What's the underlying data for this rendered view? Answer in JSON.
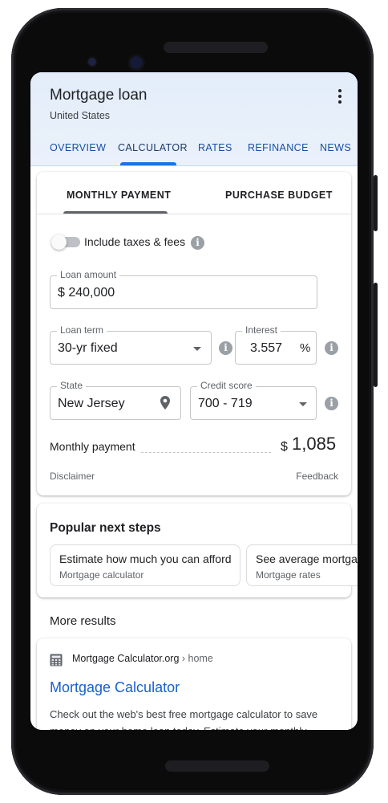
{
  "header": {
    "title": "Mortgage loan",
    "subtitle": "United States",
    "tabs": [
      {
        "label": "OVERVIEW"
      },
      {
        "label": "CALCULATOR",
        "active": true
      },
      {
        "label": "RATES"
      },
      {
        "label": "REFINANCE"
      },
      {
        "label": "NEWS"
      }
    ]
  },
  "calculator": {
    "tabs": [
      {
        "label": "MONTHLY PAYMENT",
        "active": true
      },
      {
        "label": "PURCHASE BUDGET"
      }
    ],
    "toggle": {
      "label": "Include taxes & fees",
      "on": false
    },
    "loan_amount": {
      "label": "Loan amount",
      "value": "$ 240,000"
    },
    "loan_term": {
      "label": "Loan term",
      "value": "30-yr fixed"
    },
    "interest": {
      "label": "Interest",
      "value": "3.557",
      "unit": "%"
    },
    "state": {
      "label": "State",
      "value": "New Jersey"
    },
    "credit_score": {
      "label": "Credit score",
      "value": "700 - 719"
    },
    "monthly_payment": {
      "label": "Monthly payment",
      "currency": "$",
      "value": "1,085"
    },
    "disclaimer": "Disclaimer",
    "feedback": "Feedback"
  },
  "next_steps": {
    "title": "Popular next steps",
    "chips": [
      {
        "title": "Estimate how much you can afford",
        "subtitle": "Mortgage calculator"
      },
      {
        "title": "See average mortga",
        "subtitle": "Mortgage rates"
      }
    ]
  },
  "more_results": {
    "heading": "More results",
    "result": {
      "site": "Mortgage Calculator.org",
      "path": " › home",
      "title": "Mortgage Calculator",
      "snippet": "Check out the web's best free mortgage calculator to save money on your home loan today. Estimate your monthly"
    }
  },
  "colors": {
    "accent": "#1a73e8",
    "link": "#1a5fd0",
    "header_bg": "#e3edf9"
  }
}
